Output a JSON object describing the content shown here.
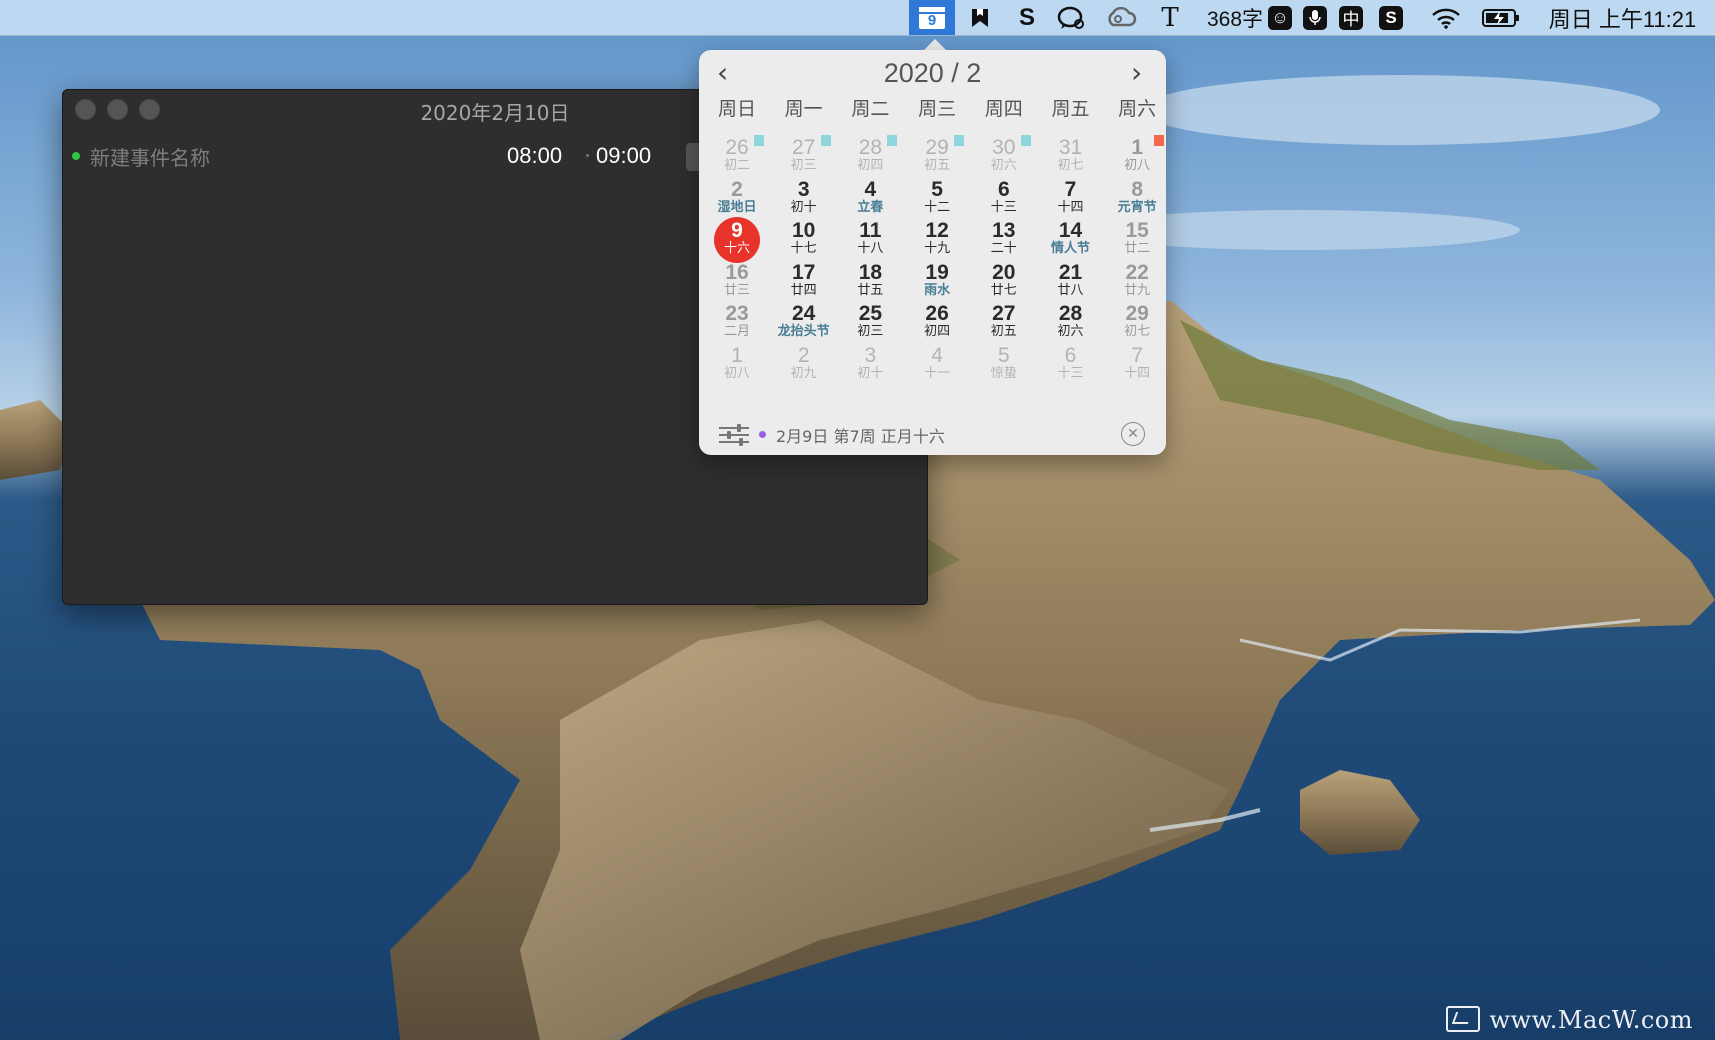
{
  "menubar": {
    "calendar_day": "9",
    "word_count": "368字",
    "ime_label": "中",
    "clock": "周日 上午11:21",
    "icons": [
      "calendar-icon",
      "bookmark-icon",
      "s-app-icon",
      "chat-search-icon",
      "creative-cloud-icon",
      "type-tool-icon",
      "smiley-icon",
      "microphone-icon",
      "input-method-icon",
      "sogou-icon",
      "wifi-icon",
      "battery-icon"
    ]
  },
  "event_window": {
    "title": "2020年2月10日",
    "event": {
      "name_placeholder": "新建事件名称",
      "start_time": "08:00",
      "end_time": "09:00",
      "dot_color": "#2fc843"
    }
  },
  "calendar": {
    "header": "2020 / 2",
    "prev": "‹",
    "next": "›",
    "weekdays": [
      "周日",
      "周一",
      "周二",
      "周三",
      "周四",
      "周五",
      "周六"
    ],
    "days": [
      {
        "num": "26",
        "lunar": "初二",
        "muted": true,
        "flag": "teal"
      },
      {
        "num": "27",
        "lunar": "初三",
        "muted": true,
        "flag": "teal"
      },
      {
        "num": "28",
        "lunar": "初四",
        "muted": true,
        "flag": "teal"
      },
      {
        "num": "29",
        "lunar": "初五",
        "muted": true,
        "flag": "teal"
      },
      {
        "num": "30",
        "lunar": "初六",
        "muted": true,
        "flag": "teal"
      },
      {
        "num": "31",
        "lunar": "初七",
        "muted": true
      },
      {
        "num": "1",
        "lunar": "初八",
        "weekend": true,
        "flag": "red"
      },
      {
        "num": "2",
        "lunar": "湿地日",
        "weekend": true,
        "festival": true
      },
      {
        "num": "3",
        "lunar": "初十"
      },
      {
        "num": "4",
        "lunar": "立春",
        "festival": true
      },
      {
        "num": "5",
        "lunar": "十二"
      },
      {
        "num": "6",
        "lunar": "十三"
      },
      {
        "num": "7",
        "lunar": "十四"
      },
      {
        "num": "8",
        "lunar": "元宵节",
        "weekend": true,
        "festival": true
      },
      {
        "num": "9",
        "lunar": "十六",
        "today": true
      },
      {
        "num": "10",
        "lunar": "十七"
      },
      {
        "num": "11",
        "lunar": "十八"
      },
      {
        "num": "12",
        "lunar": "十九"
      },
      {
        "num": "13",
        "lunar": "二十"
      },
      {
        "num": "14",
        "lunar": "情人节",
        "festival": true
      },
      {
        "num": "15",
        "lunar": "廿二",
        "weekend": true
      },
      {
        "num": "16",
        "lunar": "廿三",
        "weekend": true
      },
      {
        "num": "17",
        "lunar": "廿四"
      },
      {
        "num": "18",
        "lunar": "廿五"
      },
      {
        "num": "19",
        "lunar": "雨水",
        "festival": true
      },
      {
        "num": "20",
        "lunar": "廿七"
      },
      {
        "num": "21",
        "lunar": "廿八"
      },
      {
        "num": "22",
        "lunar": "廿九",
        "weekend": true
      },
      {
        "num": "23",
        "lunar": "二月",
        "weekend": true
      },
      {
        "num": "24",
        "lunar": "龙抬头节",
        "festival": true
      },
      {
        "num": "25",
        "lunar": "初三"
      },
      {
        "num": "26",
        "lunar": "初四"
      },
      {
        "num": "27",
        "lunar": "初五"
      },
      {
        "num": "28",
        "lunar": "初六"
      },
      {
        "num": "29",
        "lunar": "初七",
        "weekend": true
      },
      {
        "num": "1",
        "lunar": "初八",
        "muted": true
      },
      {
        "num": "2",
        "lunar": "初九",
        "muted": true
      },
      {
        "num": "3",
        "lunar": "初十",
        "muted": true
      },
      {
        "num": "4",
        "lunar": "十一",
        "muted": true
      },
      {
        "num": "5",
        "lunar": "惊蛰",
        "muted": true
      },
      {
        "num": "6",
        "lunar": "十三",
        "muted": true
      },
      {
        "num": "7",
        "lunar": "十四",
        "muted": true
      }
    ],
    "footer": {
      "text": "2月9日 第7周 正月十六",
      "dot_color": "#9a5fe0"
    }
  },
  "watermark": "www.MacW.com",
  "colors": {
    "today": "#e8332a",
    "flag_teal": "#8fd6dc",
    "flag_red": "#f2684a",
    "menubar_highlight": "#2f78d8"
  }
}
